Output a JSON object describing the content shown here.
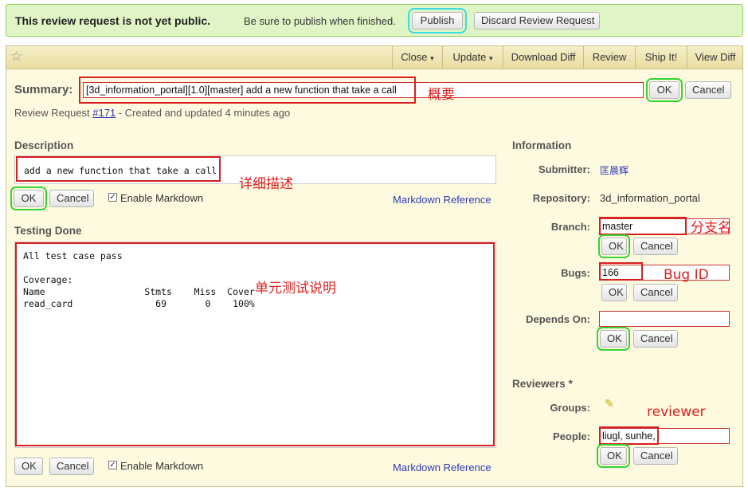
{
  "banner": {
    "headline": "This review request is not yet public.",
    "hint": "Be sure to publish when finished.",
    "publish_label": "Publish",
    "discard_label": "Discard Review Request"
  },
  "actions": {
    "close": "Close",
    "update": "Update",
    "download_diff": "Download Diff",
    "review": "Review",
    "ship_it": "Ship It!",
    "view_diff": "View Diff",
    "dropdown_glyph": "▾",
    "star_glyph": "☆"
  },
  "summary": {
    "label": "Summary:",
    "value": "[3d_information_portal][1.0][master] add a new function that take a call",
    "ok": "OK",
    "cancel": "Cancel",
    "annotation": "概要"
  },
  "meta": {
    "prefix": "Review Request",
    "id_link": "#171",
    "suffix": "- Created and updated 4 minutes ago"
  },
  "description": {
    "title": "Description",
    "text": "add a new function that take a call",
    "ok": "OK",
    "cancel": "Cancel",
    "markdown_label": "Enable Markdown",
    "markdown_ref": "Markdown Reference",
    "annotation": "详细描述"
  },
  "testing": {
    "title": "Testing Done",
    "text": "All test case pass\n\nCoverage:\nName                  Stmts    Miss  Cover\nread_card               69       0    100%",
    "ok": "OK",
    "cancel": "Cancel",
    "markdown_label": "Enable Markdown",
    "markdown_ref": "Markdown Reference",
    "annotation": "单元测试说明"
  },
  "information": {
    "title": "Information",
    "submitter_label": "Submitter:",
    "submitter_value": "匡晨辉",
    "repository_label": "Repository:",
    "repository_value": "3d_information_portal",
    "branch_label": "Branch:",
    "branch_value": "master",
    "branch_annotation": "分支名",
    "bugs_label": "Bugs:",
    "bugs_value": "166",
    "bugs_annotation": "Bug ID",
    "depends_label": "Depends On:",
    "depends_value": "",
    "ok": "OK",
    "cancel": "Cancel"
  },
  "reviewers": {
    "title": "Reviewers",
    "required_mark": "*",
    "groups_label": "Groups:",
    "people_label": "People:",
    "people_value": "liugl, sunhe,",
    "annotation": "reviewer",
    "ok": "OK",
    "cancel": "Cancel"
  },
  "colors": {
    "banner_bg": "#dff5c5",
    "banner_border": "#8fcf5f",
    "panel_bg": "#fefadf",
    "header_bg": "#f0e6b4",
    "annotation_red": "#e02020",
    "highlight_green": "#36d336"
  }
}
